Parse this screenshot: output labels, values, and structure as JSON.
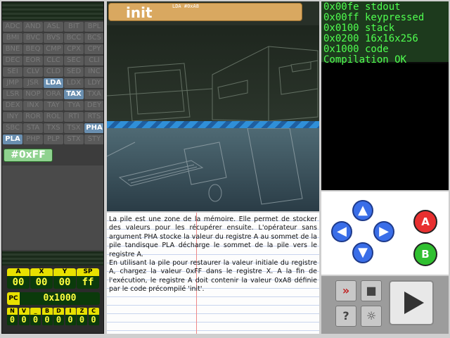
{
  "opcodes": [
    "ADC",
    "AND",
    "ASL",
    "BIT",
    "BPL",
    "BMI",
    "BVC",
    "BVS",
    "BCC",
    "BCS",
    "BNE",
    "BEQ",
    "CMP",
    "CPX",
    "CPY",
    "DEC",
    "EOR",
    "CLC",
    "SEC",
    "CLI",
    "SEI",
    "CLV",
    "CLD",
    "SED",
    "INC",
    "JMP",
    "JSR",
    "LDA",
    "LDX",
    "LDY",
    "LSR",
    "NOP",
    "ORA",
    "TAX",
    "TXA",
    "DEX",
    "INX",
    "TAY",
    "TYA",
    "DEY",
    "INY",
    "ROR",
    "ROL",
    "RTI",
    "RTS",
    "SBC",
    "STA",
    "TXS",
    "TSX",
    "PHA",
    "PLA",
    "PHP",
    "PLP",
    "STX",
    "STY"
  ],
  "highlighted": [
    "LDA",
    "TAX",
    "PHA",
    "PLA"
  ],
  "value_button": "#0xFF",
  "registers": {
    "a_label": "A",
    "a_value": "00",
    "x_label": "X",
    "x_value": "00",
    "y_label": "Y",
    "y_value": "00",
    "sp_label": "SP",
    "sp_value": "ff",
    "pc_label": "PC",
    "pc_value": "0x1000"
  },
  "flags": [
    {
      "label": "N",
      "value": "0"
    },
    {
      "label": "V",
      "value": "0"
    },
    {
      "label": "_",
      "value": "0"
    },
    {
      "label": "B",
      "value": "0"
    },
    {
      "label": "D",
      "value": "0"
    },
    {
      "label": "I",
      "value": "0"
    },
    {
      "label": "Z",
      "value": "0"
    },
    {
      "label": "C",
      "value": "0"
    }
  ],
  "scene": {
    "title": "init",
    "subtitle": "LDA #0xA8"
  },
  "description_1": "La pile est une zone de la mémoire. Elle permet de stocker des valeurs pour les récupérer ensuite. L'opérateur sans argument PHA stocke la valeur du registre A au sommet de la pile tandisque PLA décharge le sommet de la pile vers le registre A.",
  "description_2": "En utilisant la pile pour restaurer la valeur initiale du registre A, chargez la valeur 0xFF dans le registre X. A la fin de l'exécution, le registre A doit contenir la valeur 0xA8 définie par le code précompilé 'init'.",
  "console_lines": [
    "0x00fe stdout",
    "0x00ff keypressed",
    "0x0100 stack",
    "0x0200 16x16x256",
    "0x1000 code",
    "Compilation OK"
  ],
  "gamepad": {
    "a_label": "A",
    "b_label": "B"
  },
  "colors": {
    "accent_green": "#50ff50",
    "reg_yellow": "#e8e000",
    "highlight_blue": "#6a8fb0"
  }
}
